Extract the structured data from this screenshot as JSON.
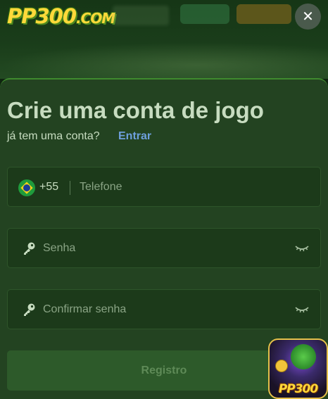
{
  "header": {
    "logo_text": "PP300",
    "logo_suffix": ".COM"
  },
  "modal": {
    "close_label": "✕",
    "title": "Crie uma conta de jogo",
    "subtitle": "já tem uma conta?",
    "login_link": "Entrar",
    "phone": {
      "dial_code": "+55",
      "placeholder": "Telefone",
      "country_flag": "brazil-flag"
    },
    "password": {
      "placeholder": "Senha"
    },
    "confirm_password": {
      "placeholder": "Confirmar senha"
    },
    "submit_label": "Registro"
  },
  "app_badge": {
    "label": "PP300"
  },
  "colors": {
    "sheet_bg": "#234321",
    "field_bg": "#1c3a1a",
    "link": "#6e9fdc",
    "button_bg": "#2d5a2a",
    "logo_yellow": "#ffd93a"
  }
}
